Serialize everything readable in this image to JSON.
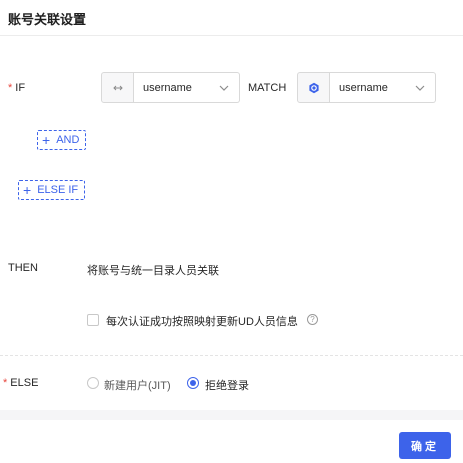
{
  "dialog": {
    "title": "账号关联设置"
  },
  "if_row": {
    "label": "IF",
    "required_mark": "*",
    "left_field": {
      "value": "username",
      "icon": "ad-connector-icon"
    },
    "operator": "MATCH",
    "right_field": {
      "value": "username",
      "icon": "ud-identity-icon"
    }
  },
  "and_button": {
    "label": "AND"
  },
  "else_if_button": {
    "label": "ELSE IF"
  },
  "then_row": {
    "label": "THEN",
    "text": "将账号与统一目录人员关联"
  },
  "sync_option": {
    "label": "每次认证成功按照映射更新UD人员信息",
    "checked": false
  },
  "else_row": {
    "label": "ELSE",
    "required_mark": "*",
    "options": [
      {
        "label": "新建用户(JIT)",
        "selected": false
      },
      {
        "label": "拒绝登录",
        "selected": true
      }
    ]
  },
  "footer": {
    "confirm_label": "确定"
  },
  "colors": {
    "primary": "#3d63ea",
    "required": "#e8453c"
  }
}
